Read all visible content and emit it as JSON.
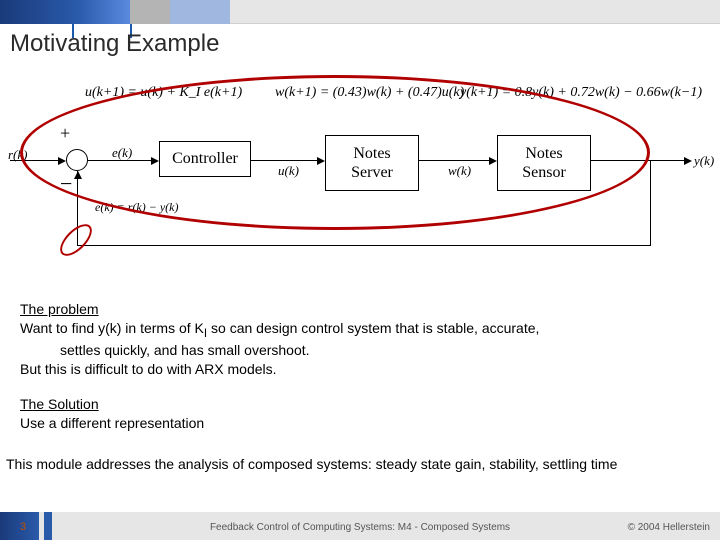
{
  "title": "Motivating Example",
  "diagram": {
    "eq_controller": "u(k+1) = u(k) + K_I e(k+1)",
    "eq_server": "w(k+1) = (0.43)w(k) + (0.47)u(k)",
    "eq_sensor": "y(k+1) = 0.8y(k) + 0.72w(k) − 0.66w(k−1)",
    "plus": "+",
    "minus": "−",
    "block_controller": "Controller",
    "block_server_l1": "Notes",
    "block_server_l2": "Server",
    "block_sensor_l1": "Notes",
    "block_sensor_l2": "Sensor",
    "sig_r": "r(k)",
    "sig_e": "e(k)",
    "sig_u": "u(k)",
    "sig_w": "w(k)",
    "sig_y": "y(k)",
    "feedback_eq": "e(k) = r(k) − y(k)"
  },
  "problem_heading": "The problem",
  "problem_line1_a": "Want to find y(k) in terms of K",
  "problem_line1_sub": "I",
  "problem_line1_b": " so can design control system that is stable, accurate,",
  "problem_line2": "settles quickly, and has small overshoot.",
  "problem_line3": "But this is difficult to do with ARX models.",
  "solution_heading": "The Solution",
  "solution_line1": "Use a different representation",
  "module_note": "This module addresses the analysis of composed systems: steady state gain, stability, settling time",
  "footer": {
    "page": "3",
    "center": "Feedback Control of Computing Systems: M4 - Composed Systems",
    "right": "© 2004 Hellerstein"
  }
}
